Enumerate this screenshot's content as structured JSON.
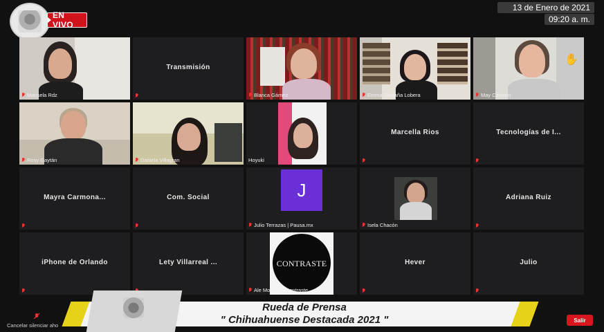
{
  "header": {
    "live_label": "EN VIVO",
    "date": "13 de Enero de 2021",
    "time": "09:20 a. m."
  },
  "tiles": [
    {
      "name": "Marisela Rdz",
      "type": "video"
    },
    {
      "name": "Transmisión",
      "type": "name"
    },
    {
      "name": "Blanca Gámez",
      "type": "video"
    },
    {
      "name": "Emma Saldaña Lobera",
      "type": "video"
    },
    {
      "name": "May Carreón",
      "type": "video"
    },
    {
      "name": "Rosy Gaytán",
      "type": "video"
    },
    {
      "name": "Daniela Villagran",
      "type": "video"
    },
    {
      "name": "Hoyuki",
      "type": "video"
    },
    {
      "name": "Marcella Rios",
      "type": "name"
    },
    {
      "name": "Tecnologías de I...",
      "type": "name"
    },
    {
      "name": "Mayra Carmona...",
      "type": "name"
    },
    {
      "name": "Com. Social",
      "type": "name"
    },
    {
      "name": "Julio Terrazas | Pausa.mx",
      "type": "avatar",
      "initial": "J"
    },
    {
      "name": "Isela Chacón",
      "type": "video"
    },
    {
      "name": "Adriana Ruiz",
      "type": "name"
    },
    {
      "name": "iPhone de Orlando",
      "type": "name"
    },
    {
      "name": "Lety Villarreal ...",
      "type": "name"
    },
    {
      "name": "Ale Morales | Contraste",
      "type": "logo",
      "logo_text": "CONTRASTE"
    },
    {
      "name": "Hever",
      "type": "name"
    },
    {
      "name": "Julio",
      "type": "name"
    }
  ],
  "banner": {
    "line1": "Rueda de Prensa",
    "line2": "\" Chihuahuense Destacada 2021 \""
  },
  "footer": {
    "cancel_label": "Cancelar silenciar aho",
    "leave_label": "Salir"
  },
  "colors": {
    "live": "#d0121b",
    "active_speaker": "#d4e04a",
    "banner_accent": "#e7d21a",
    "tile_bg": "#1e1e20"
  },
  "icons": [
    "logo-icon",
    "raise-hand-icon",
    "mic-muted-icon",
    "mute-all-icon"
  ]
}
